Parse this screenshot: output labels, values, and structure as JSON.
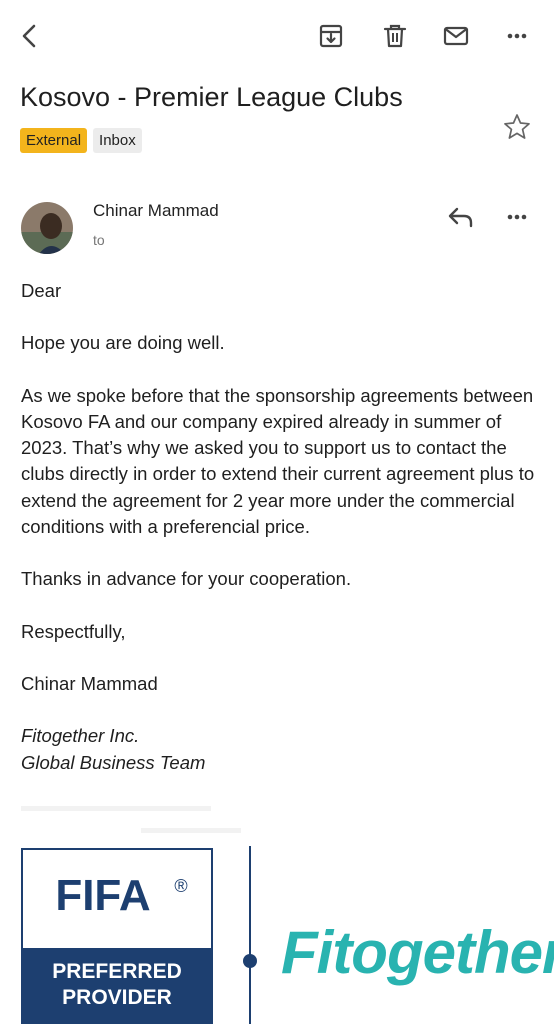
{
  "toolbar": {
    "back_icon": "back-arrow-icon",
    "archive_icon": "archive-icon",
    "delete_icon": "trash-icon",
    "mark_unread_icon": "mail-icon",
    "more_icon": "more-horizontal-icon"
  },
  "email": {
    "subject": "Kosovo - Premier League Clubs",
    "labels": [
      "External",
      "Inbox"
    ],
    "sender_name": "Chinar Mammad",
    "to_label": "to",
    "body": {
      "greeting": "Dear",
      "p1": "Hope you are doing well.",
      "p2": "As we spoke before that the sponsorship agreements between Kosovo FA and our company expired already in summer of 2023. That’s why we asked you to support us to contact the clubs directly in order to extend their current agreement plus to extend the agreement for 2 year more under the commercial conditions with a preferencial price.",
      "p3": "Thanks in advance for your cooperation.",
      "closing": "Respectfully,",
      "signature_name": "Chinar Mammad",
      "company": "Fitogether Inc.",
      "team": "Global Business Team"
    }
  },
  "logos": {
    "fifa_text": "FIFA",
    "fifa_reg": "®",
    "preferred": "PREFERRED",
    "provider": "PROVIDER",
    "fitogether": "Fitogether"
  },
  "colors": {
    "external_label": "#f3b41c",
    "inbox_label": "#ececec",
    "fifa_blue": "#1d3f70",
    "fitogether_teal": "#29b3b0"
  }
}
